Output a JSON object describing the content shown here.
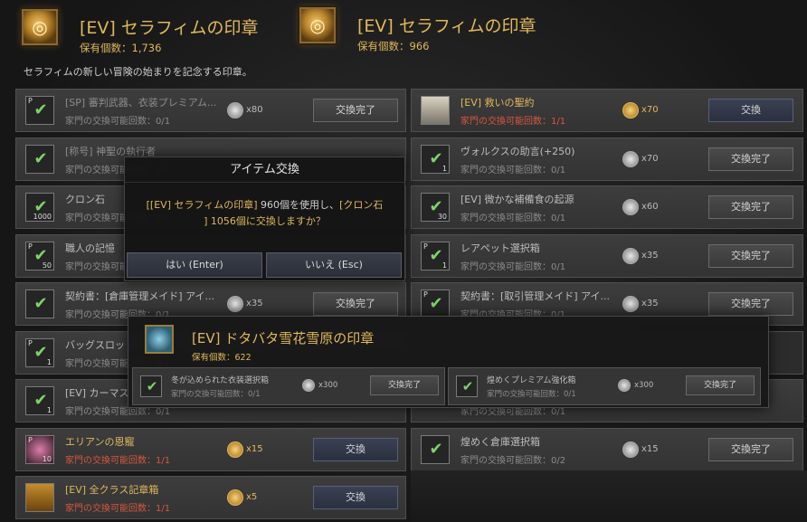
{
  "header": {
    "left": {
      "title": "[EV] セラフィムの印章",
      "count": "保有個数：1,736"
    },
    "right": {
      "title": "[EV] セラフィムの印章",
      "count": "保有個数：966"
    },
    "description": "セラフィムの新しい冒険の始まりを記念する印章。"
  },
  "left_rows": [
    {
      "name": "[SP] 審判武器、衣装プレミアム...",
      "limit": "家門の交換可能回数：0/1",
      "cost": "x80",
      "button": "交換完了",
      "slot_p": "P",
      "slot_n": ""
    },
    {
      "name": "[称号] 神聖の執行者",
      "limit": "家門の交換可能回数：0/1",
      "cost": "",
      "button": "",
      "slot_p": "",
      "slot_n": ""
    },
    {
      "name": "クロン石",
      "limit": "家門の交換可能回数：0/1",
      "cost": "",
      "button": "",
      "slot_p": "",
      "slot_n": "1000"
    },
    {
      "name": "職人の記憶",
      "limit": "家門の交換可能回数：0/1",
      "cost": "",
      "button": "",
      "slot_p": "P",
      "slot_n": "50"
    },
    {
      "name": "契約書：[倉庫管理メイド] アイ...",
      "limit": "家門の交換可能回数：0/1",
      "cost": "x35",
      "button": "交換完了",
      "slot_p": "",
      "slot_n": ""
    },
    {
      "name": "バッグスロット",
      "limit": "家門の交換可能回数：0/1",
      "cost": "",
      "button": "",
      "slot_p": "P",
      "slot_n": "1"
    },
    {
      "name": "[EV] カーマスリビアの祝福",
      "limit": "家門の交換可能回数：0/1",
      "cost": "",
      "button": "",
      "slot_p": "",
      "slot_n": "1"
    },
    {
      "name": "エリアンの恩寵",
      "limit": "家門の交換可能回数：1/1",
      "cost": "x15",
      "button": "交換",
      "slot_p": "P",
      "slot_n": "10"
    },
    {
      "name": "[EV] 全クラス記章箱",
      "limit": "家門の交換可能回数：1/1",
      "cost": "x5",
      "button": "交換",
      "slot_p": "",
      "slot_n": ""
    }
  ],
  "right_rows": [
    {
      "name": "[EV] 救いの聖約",
      "limit": "家門の交換可能回数：1/1",
      "cost": "x70",
      "button": "交換",
      "slot_p": "",
      "slot_n": ""
    },
    {
      "name": "ヴォルクスの助言(+250)",
      "limit": "家門の交換可能回数：0/1",
      "cost": "x70",
      "button": "交換完了",
      "slot_p": "",
      "slot_n": "1"
    },
    {
      "name": "[EV] 微かな補備食の起源",
      "limit": "家門の交換可能回数：0/1",
      "cost": "x60",
      "button": "交換完了",
      "slot_p": "",
      "slot_n": "30"
    },
    {
      "name": "レアペット選択箱",
      "limit": "家門の交換可能回数：0/1",
      "cost": "x35",
      "button": "交換完了",
      "slot_p": "P",
      "slot_n": "1"
    },
    {
      "name": "契約書：[取引管理メイド] アイ...",
      "limit": "家門の交換可能回数：0/1",
      "cost": "x35",
      "button": "交換完了",
      "slot_p": "P",
      "slot_n": ""
    },
    {
      "name": "",
      "limit": "",
      "cost": "",
      "button": "",
      "slot_p": "",
      "slot_n": ""
    },
    {
      "name": "",
      "limit": "家門の交換可能回数：0/1",
      "cost": "",
      "button": "",
      "slot_p": "",
      "slot_n": ""
    },
    {
      "name": "煌めく倉庫選択箱",
      "limit": "家門の交換可能回数：0/2",
      "cost": "x15",
      "button": "交換完了",
      "slot_p": "",
      "slot_n": ""
    }
  ],
  "dialog": {
    "title": "アイテム交換",
    "msg_part1": "[[EV] セラフィムの印章]",
    "msg_part2": " 960個を使用し、",
    "msg_part3": "[クロン石",
    "msg_part4": "] 1056個に交換しますか？",
    "yes": "はい (Enter)",
    "no": "いいえ (Esc)"
  },
  "panel": {
    "title": "[EV] ドタバタ雪花雪原の印章",
    "count": "保有個数：622",
    "rows": [
      {
        "name": "冬が込められた衣装選択箱",
        "limit": "家門の交換可能回数：0/1",
        "cost": "x300",
        "button": "交換完了"
      },
      {
        "name": "煌めくプレミアム強化箱",
        "limit": "家門の交換可能回数：0/1",
        "cost": "x300",
        "button": "交換完了"
      }
    ]
  },
  "colors": {
    "accent": "#e0b85a",
    "check": "#7ed46a",
    "limit_red": "#d8573f"
  }
}
